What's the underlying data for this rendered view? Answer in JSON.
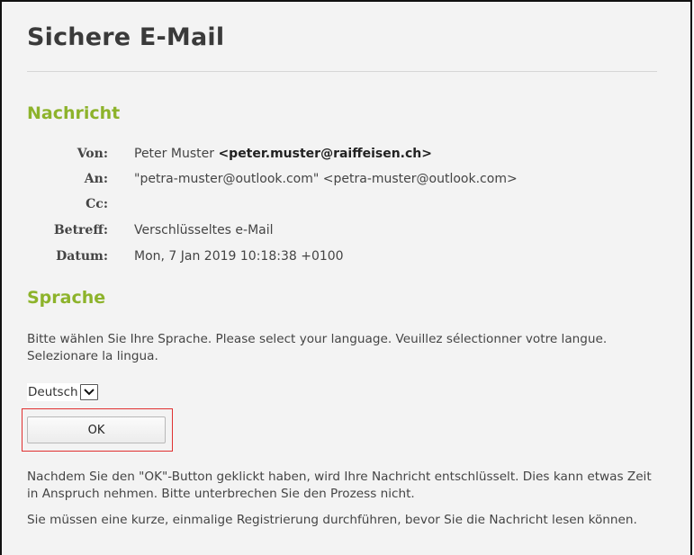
{
  "page": {
    "title": "Sichere E-Mail"
  },
  "message": {
    "heading": "Nachricht",
    "from_label": "Von:",
    "from_name": "Peter Muster",
    "from_email": "<peter.muster@raiffeisen.ch>",
    "to_label": "An:",
    "to_value": "\"petra-muster@outlook.com\" <petra-muster@outlook.com>",
    "cc_label": "Cc:",
    "cc_value": "",
    "subject_label": "Betreff:",
    "subject_value": "Verschlüsseltes e-Mail",
    "date_label": "Datum:",
    "date_value": "Mon, 7 Jan 2019 10:18:38 +0100"
  },
  "language": {
    "heading": "Sprache",
    "instructions": "Bitte wählen Sie Ihre Sprache. Please select your language. Veuillez sélectionner votre langue. Selezionare la lingua.",
    "selected": "Deutsch",
    "ok_label": "OK",
    "info_decrypt": "Nachdem Sie den \"OK\"-Button geklickt haben, wird Ihre Nachricht entschlüsselt. Dies kann etwas Zeit in Anspruch nehmen. Bitte unterbrechen Sie den Prozess nicht.",
    "info_register": "Sie müssen eine kurze, einmalige Registrierung durchführen, bevor Sie die Nachricht lesen können."
  },
  "icons": {
    "dropdown": "chevron-down-icon"
  },
  "colors": {
    "accent": "#8db32b",
    "highlight": "#e03030",
    "background": "#f3f3f3"
  }
}
